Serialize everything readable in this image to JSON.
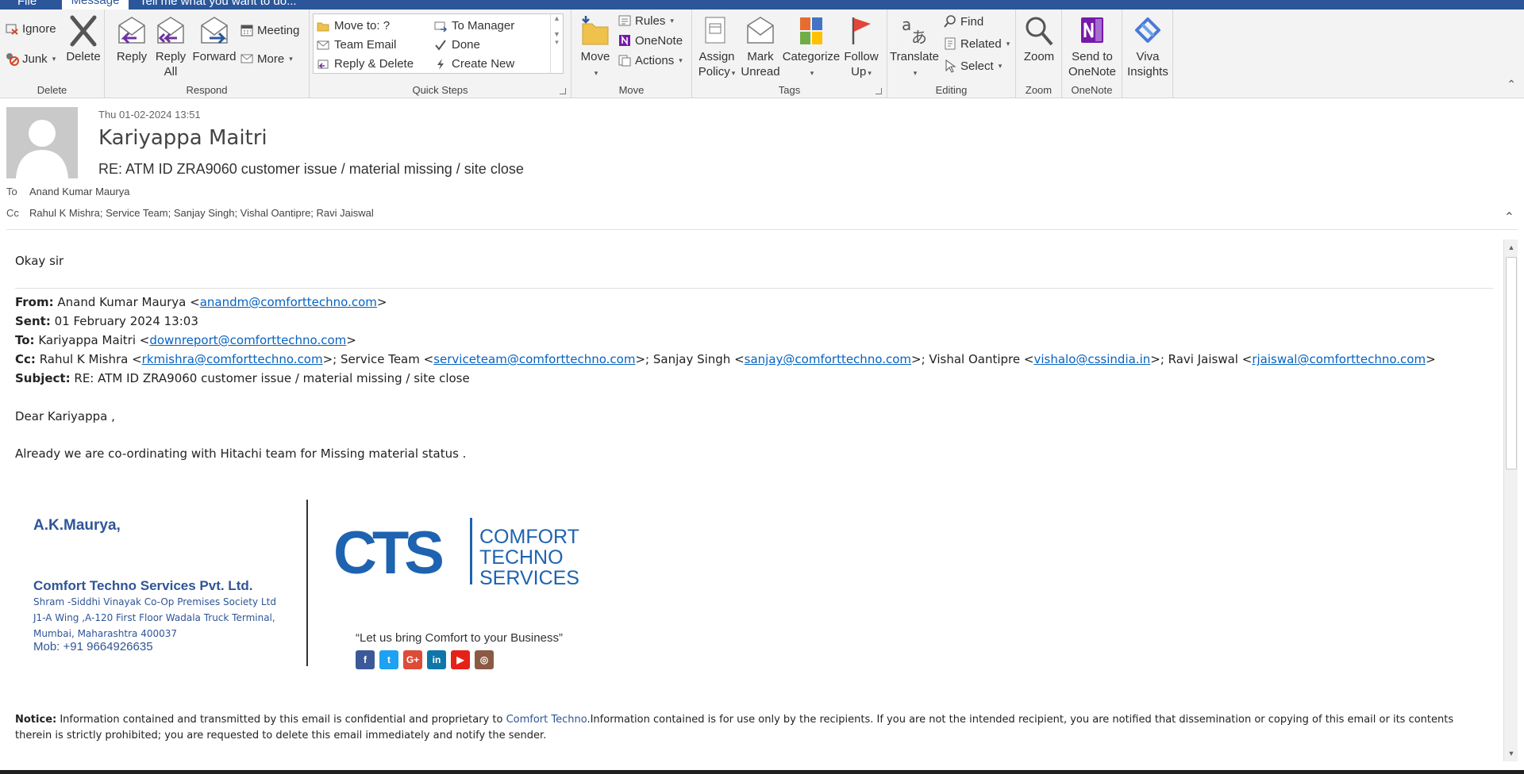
{
  "tabs": {
    "file": "File",
    "message": "Message",
    "tell_me": "Tell me what you want to do..."
  },
  "ribbon": {
    "delete_group": {
      "label": "Delete",
      "ignore": "Ignore",
      "junk": "Junk",
      "delete": "Delete"
    },
    "respond_group": {
      "label": "Respond",
      "reply": "Reply",
      "reply_all_1": "Reply",
      "reply_all_2": "All",
      "forward": "Forward",
      "meeting": "Meeting",
      "more": "More"
    },
    "quicksteps_group": {
      "label": "Quick Steps",
      "items": [
        "Move to: ?",
        "To Manager",
        "Team Email",
        "Done",
        "Reply & Delete",
        "Create New"
      ]
    },
    "move_group": {
      "label": "Move",
      "move": "Move",
      "rules": "Rules",
      "onenote": "OneNote",
      "actions": "Actions"
    },
    "tags_group": {
      "label": "Tags",
      "assign_1": "Assign",
      "assign_2": "Policy",
      "mark_1": "Mark",
      "mark_2": "Unread",
      "categorize": "Categorize",
      "follow_1": "Follow",
      "follow_2": "Up"
    },
    "editing_group": {
      "label": "Editing",
      "translate": "Translate",
      "find": "Find",
      "related": "Related",
      "select": "Select"
    },
    "zoom_group": {
      "label": "Zoom",
      "zoom": "Zoom"
    },
    "onenote_group": {
      "label": "OneNote",
      "send_1": "Send to",
      "send_2": "OneNote"
    },
    "viva": {
      "line1": "Viva",
      "line2": "Insights"
    }
  },
  "header": {
    "date": "Thu 01-02-2024 13:51",
    "sender": "Kariyappa Maitri",
    "subject": "RE: ATM ID ZRA9060 customer issue / material missing / site close",
    "to_label": "To",
    "to": "Anand Kumar Maurya",
    "cc_label": "Cc",
    "cc": "Rahul K Mishra; Service Team; Sanjay Singh; Vishal Oantipre; Ravi Jaiswal"
  },
  "body": {
    "reply": "Okay sir",
    "from_label": "From:",
    "from_name": "Anand Kumar Maurya <",
    "from_email": "anandm@comforttechno.com",
    "sent_label": "Sent:",
    "sent": "01 February 2024 13:03",
    "to_label": "To:",
    "to_name": "Kariyappa Maitri <",
    "to_email": "downreport@comforttechno.com",
    "cc_label": "Cc:",
    "cc_1_name": "Rahul K Mishra <",
    "cc_1_email": "rkmishra@comforttechno.com",
    "cc_2_name": ">; Service Team <",
    "cc_2_email": "serviceteam@comforttechno.com",
    "cc_3_name": ">; Sanjay Singh <",
    "cc_3_email": "sanjay@comforttechno.com",
    "cc_4_name": ">; Vishal Oantipre <",
    "cc_4_email": "vishalo@cssindia.in",
    "cc_5_name": ">; Ravi Jaiswal <",
    "cc_5_email": "rjaiswal@comforttechno.com",
    "subject_label": "Subject:",
    "subject": "RE: ATM ID ZRA9060 customer issue / material missing / site close",
    "greeting": "Dear Kariyappa ,",
    "message": "Already we are co-ordinating with Hitachi team for Missing material status ."
  },
  "signature": {
    "name": "A.K.Maurya,",
    "company": "Comfort Techno Services Pvt. Ltd.",
    "address_1": "Shram -Siddhi Vinayak Co-Op Premises Society Ltd",
    "address_2": "J1-A Wing ,A-120 First Floor Wadala Truck  Terminal,",
    "address_3": "Mumbai, Maharashtra 400037",
    "mobile": "Mob: +91 9664926635",
    "logo_letters": "CTS",
    "logo_line1": "COMFORT",
    "logo_line2": "TECHNO",
    "logo_line3": "SERVICES",
    "tagline": "“Let us bring Comfort to your Business”",
    "social": [
      {
        "name": "facebook",
        "glyph": "f",
        "color": "#3b5998"
      },
      {
        "name": "twitter",
        "glyph": "t",
        "color": "#1da1f2"
      },
      {
        "name": "google-plus",
        "glyph": "G+",
        "color": "#dd4b39"
      },
      {
        "name": "linkedin",
        "glyph": "in",
        "color": "#0e76a8"
      },
      {
        "name": "youtube",
        "glyph": "▶",
        "color": "#e62117"
      },
      {
        "name": "instagram",
        "glyph": "◎",
        "color": "#8a5a44"
      }
    ]
  },
  "notice": {
    "label": "Notice:",
    "text_1": " Information contained and transmitted by this email is confidential and proprietary to ",
    "brand": "Comfort Techno",
    "text_2": ".Information contained is for use only by the recipients. If you are not the intended recipient, you are notified  that dissemination or copying of this email or its contents therein is strictly prohibited; you are requested to delete this email immediately and notify the sender."
  },
  "colors": {
    "accent": "#2b579a",
    "link": "#0563c1",
    "signature": "#2f5597"
  }
}
